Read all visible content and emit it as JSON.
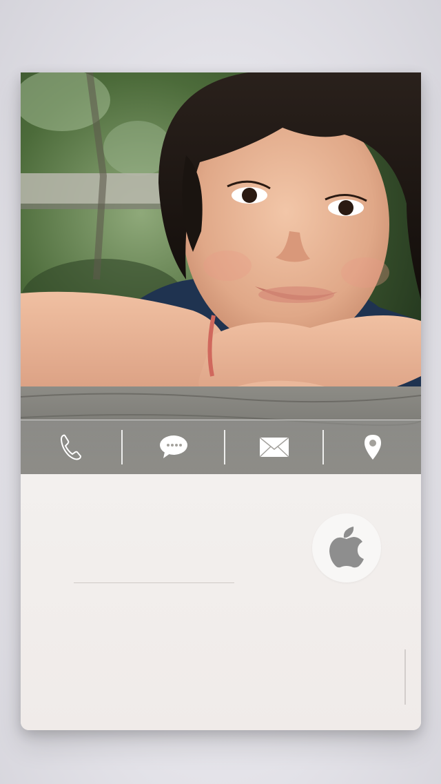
{
  "contact": {
    "name": "",
    "photo_alt": "contact-photo"
  },
  "actions": [
    {
      "name": "call",
      "icon": "phone-icon"
    },
    {
      "name": "message",
      "icon": "message-bubble-icon"
    },
    {
      "name": "email",
      "icon": "envelope-icon"
    },
    {
      "name": "location",
      "icon": "map-pin-icon"
    }
  ],
  "company": {
    "icon": "apple-logo-icon"
  },
  "colors": {
    "card_background": "#f1ecea",
    "icon_white": "#ffffff",
    "logo_gray": "#8e8e8e"
  }
}
